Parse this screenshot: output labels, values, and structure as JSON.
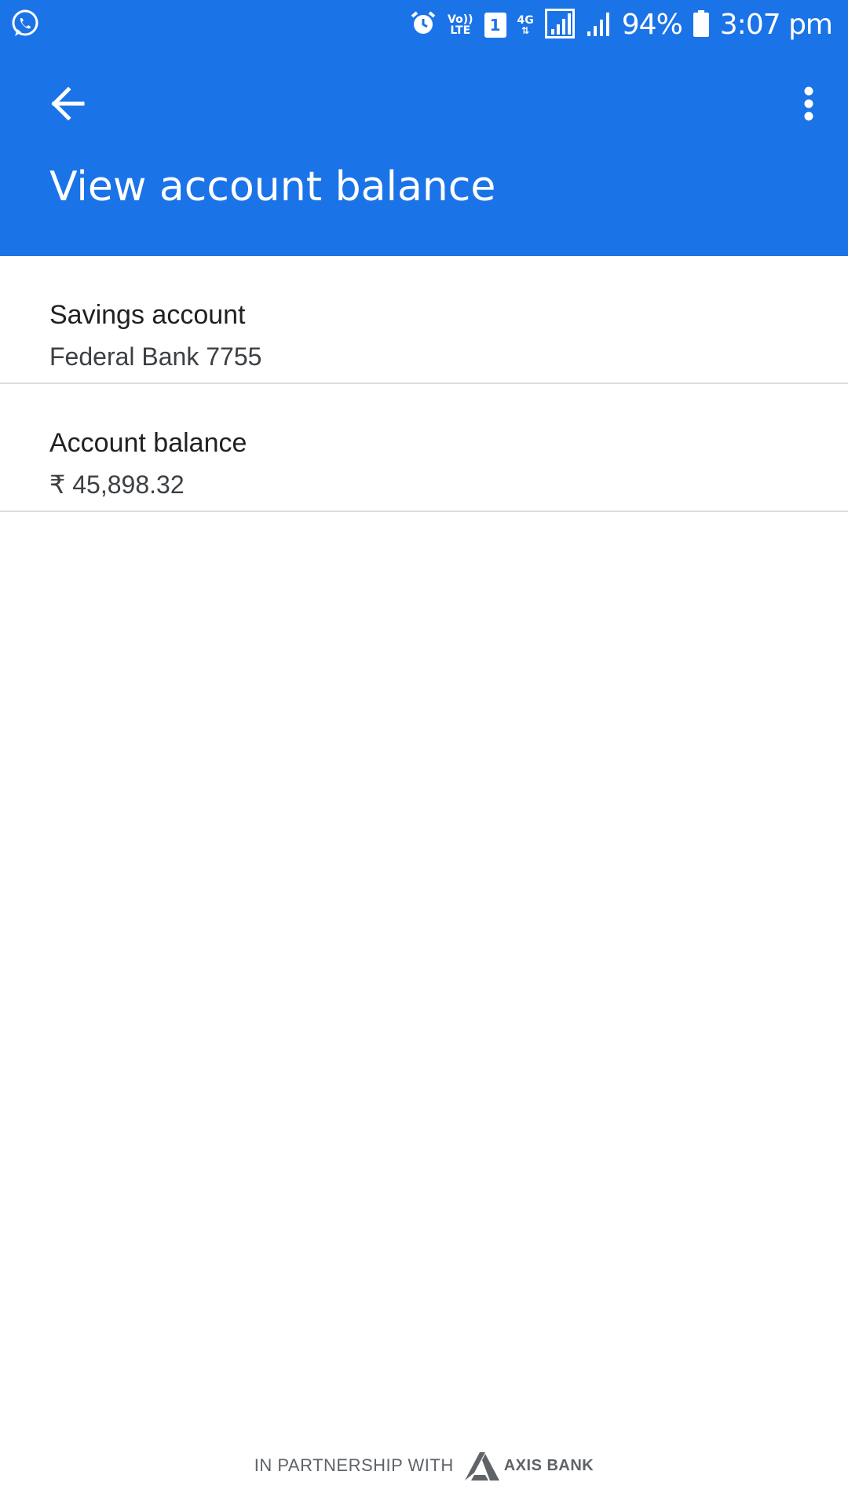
{
  "status_bar": {
    "left_icon": "whatsapp-icon",
    "icons": [
      "alarm-icon",
      "volte-icon",
      "sim-1-icon",
      "4g-data-icon",
      "signal-icon",
      "signal-icon"
    ],
    "volte_line1": "Vo))",
    "volte_line2": "LTE",
    "sim_label": "1",
    "network_label": "4G",
    "battery_percent": "94%",
    "time": "3:07 pm"
  },
  "toolbar": {
    "back_icon": "arrow-back-icon",
    "more_icon": "more-vert-icon",
    "title": "View account balance"
  },
  "list": {
    "items": [
      {
        "title": "Savings account",
        "subtitle": "Federal Bank 7755"
      },
      {
        "title": "Account balance",
        "subtitle": "₹ 45,898.32"
      }
    ]
  },
  "footer": {
    "partnership_text": "IN PARTNERSHIP WITH",
    "bank_name": "AXIS BANK",
    "logo_icon": "axis-bank-logo"
  },
  "colors": {
    "header_blue": "#1b73e8",
    "divider": "#dadce0",
    "title_text": "#202124",
    "subtitle_text": "#3c4043"
  }
}
